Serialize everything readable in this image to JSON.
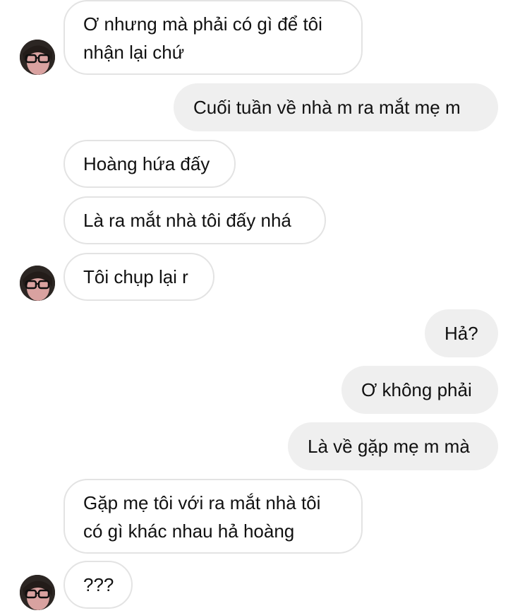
{
  "messages": [
    {
      "sender": "other",
      "text": "Ơ nhưng mà phải có gì để tôi nhận lại chứ"
    },
    {
      "sender": "me",
      "text": "Cuối tuần về nhà m ra mắt mẹ m"
    },
    {
      "sender": "other",
      "text": "Hoàng hứa đấy"
    },
    {
      "sender": "other",
      "text": "Là ra mắt nhà tôi đấy nhá"
    },
    {
      "sender": "other",
      "text": "Tôi chụp lại r"
    },
    {
      "sender": "me",
      "text": "Hả?"
    },
    {
      "sender": "me",
      "text": "Ơ không phải"
    },
    {
      "sender": "me",
      "text": "Là về gặp mẹ m mà"
    },
    {
      "sender": "other",
      "text": "Gặp mẹ tôi với ra mắt nhà tôi có gì khác nhau hả hoàng"
    },
    {
      "sender": "other",
      "text": "???"
    }
  ],
  "colors": {
    "incoming_bubble_bg": "#ffffff",
    "incoming_bubble_border": "#e3e3e3",
    "outgoing_bubble_bg": "#efefef",
    "text": "#111111"
  },
  "icons": {
    "avatar": "user-avatar-icon"
  }
}
